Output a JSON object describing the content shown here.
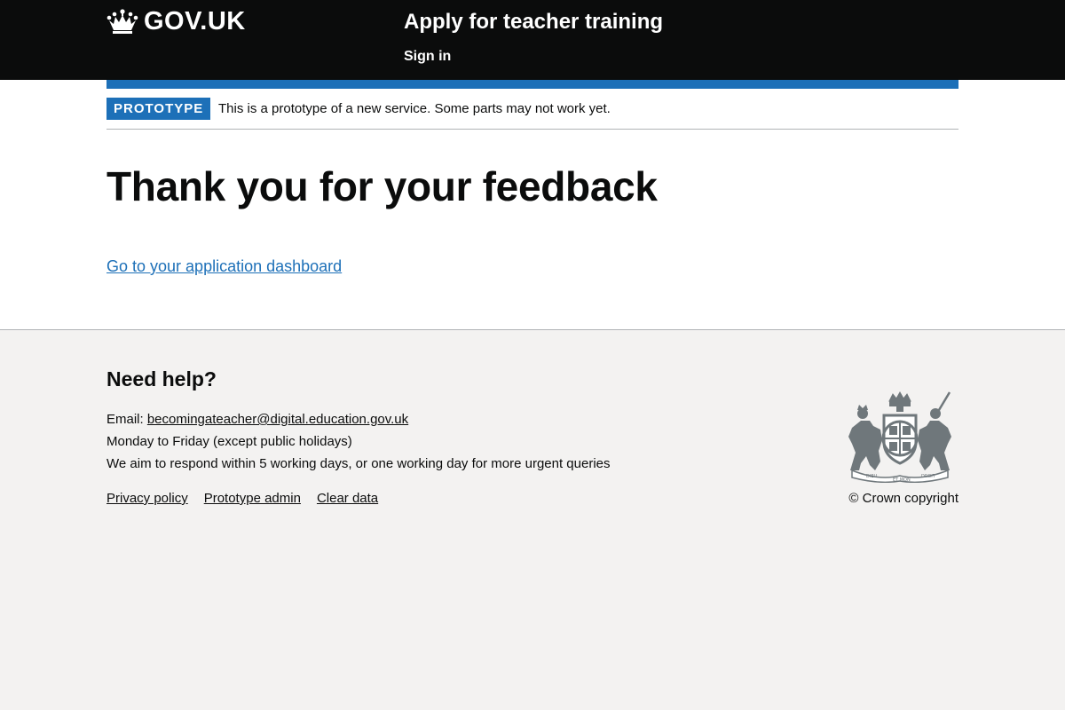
{
  "header": {
    "logo_text": "GOV.UK",
    "service_name": "Apply for teacher training",
    "sign_in": "Sign in"
  },
  "phase_banner": {
    "tag": "PROTOTYPE",
    "text": "This is a prototype of a new service. Some parts may not work yet."
  },
  "main": {
    "title": "Thank you for your feedback",
    "dashboard_link": "Go to your application dashboard"
  },
  "footer": {
    "heading": "Need help?",
    "email_label": "Email: ",
    "email": "becomingateacher@digital.education.gov.uk",
    "hours": "Monday to Friday (except public holidays)",
    "response": "We aim to respond within 5 working days, or one working day for more urgent queries",
    "links": [
      "Privacy policy",
      "Prototype admin",
      "Clear data"
    ],
    "copyright": "© Crown copyright",
    "crest_mottos": [
      "DIEU",
      "ET MON",
      "DROIT"
    ]
  },
  "colors": {
    "header_bg": "#0b0c0c",
    "brand_blue": "#1d70b8",
    "footer_bg": "#f3f2f1",
    "crest": "#6f777b"
  },
  "icons": {
    "logo": "crown-icon",
    "crest": "royal-coat-of-arms"
  }
}
